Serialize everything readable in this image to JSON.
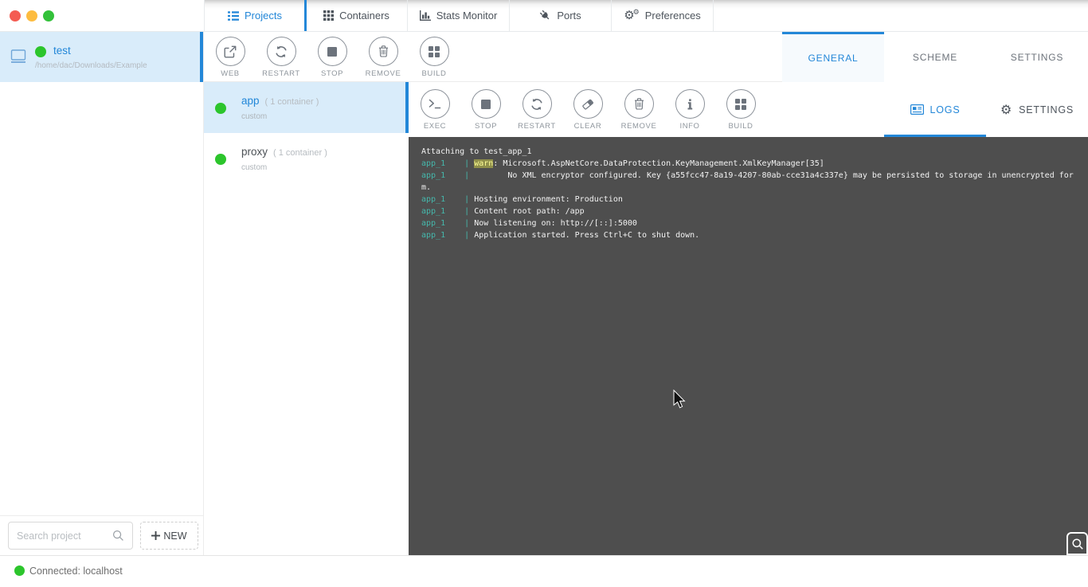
{
  "window": {
    "traffic_lights": [
      {
        "name": "close",
        "color": "#f45c52"
      },
      {
        "name": "minimize",
        "color": "#fdbc40"
      },
      {
        "name": "maximize",
        "color": "#33c13a"
      }
    ]
  },
  "nav": {
    "tabs": [
      {
        "label": "Projects",
        "icon": "list-icon",
        "active": true
      },
      {
        "label": "Containers",
        "icon": "grid9-icon",
        "active": false
      },
      {
        "label": "Stats Monitor",
        "icon": "bars-icon",
        "active": false
      },
      {
        "label": "Ports",
        "icon": "plug-icon",
        "active": false
      },
      {
        "label": "Preferences",
        "icon": "gears-icon",
        "active": false
      }
    ]
  },
  "sidebar": {
    "project": {
      "name": "test",
      "path": "/home/dac/Downloads/Example",
      "status": "running"
    },
    "search_placeholder": "Search project",
    "new_button_label": "NEW"
  },
  "project_toolbar": {
    "buttons": [
      {
        "label": "WEB",
        "icon": "external-link-icon"
      },
      {
        "label": "RESTART",
        "icon": "refresh-icon"
      },
      {
        "label": "STOP",
        "icon": "stop-icon"
      },
      {
        "label": "REMOVE",
        "icon": "trash-icon"
      },
      {
        "label": "BUILD",
        "icon": "grid4-icon"
      }
    ]
  },
  "project_tabs": [
    {
      "label": "GENERAL",
      "active": true
    },
    {
      "label": "SCHEME",
      "active": false
    },
    {
      "label": "SETTINGS",
      "active": false
    }
  ],
  "services": [
    {
      "name": "app",
      "count": "( 1 container )",
      "type": "custom",
      "status": "running",
      "selected": true
    },
    {
      "name": "proxy",
      "count": "( 1 container )",
      "type": "custom",
      "status": "running",
      "selected": false
    }
  ],
  "container_toolbar": {
    "buttons": [
      {
        "label": "EXEC",
        "icon": "terminal-icon"
      },
      {
        "label": "STOP",
        "icon": "stop-icon"
      },
      {
        "label": "RESTART",
        "icon": "refresh-icon"
      },
      {
        "label": "CLEAR",
        "icon": "eraser-icon"
      },
      {
        "label": "REMOVE",
        "icon": "trash-icon"
      },
      {
        "label": "INFO",
        "icon": "info-icon"
      },
      {
        "label": "BUILD",
        "icon": "grid4-icon"
      }
    ]
  },
  "log_tabs": [
    {
      "label": "LOGS",
      "icon": "logs-icon",
      "active": true
    },
    {
      "label": "SETTINGS",
      "icon": "gear-icon",
      "active": false
    }
  ],
  "logs": {
    "lines": [
      {
        "segments": [
          {
            "t": "Attaching to test_app_1",
            "c": "plain"
          }
        ]
      },
      {
        "segments": [
          {
            "t": "app_1    | ",
            "c": "service"
          },
          {
            "t": "warn",
            "c": "warn"
          },
          {
            "t": ": Microsoft.AspNetCore.DataProtection.KeyManagement.XmlKeyManager[35]",
            "c": "plain"
          }
        ]
      },
      {
        "segments": [
          {
            "t": "app_1    | ",
            "c": "service"
          },
          {
            "t": "       No XML encryptor configured. Key {a55fcc47-8a19-4207-80ab-cce31a4c337e} may be persisted to storage in unencrypted for",
            "c": "plain"
          }
        ]
      },
      {
        "segments": [
          {
            "t": "m.",
            "c": "plain"
          }
        ]
      },
      {
        "segments": [
          {
            "t": "app_1    | ",
            "c": "service"
          },
          {
            "t": "Hosting environment: Production",
            "c": "plain"
          }
        ]
      },
      {
        "segments": [
          {
            "t": "app_1    | ",
            "c": "service"
          },
          {
            "t": "Content root path: /app",
            "c": "plain"
          }
        ]
      },
      {
        "segments": [
          {
            "t": "app_1    | ",
            "c": "service"
          },
          {
            "t": "Now listening on: http://[::]:5000",
            "c": "plain"
          }
        ]
      },
      {
        "segments": [
          {
            "t": "app_1    | ",
            "c": "service"
          },
          {
            "t": "Application started. Press Ctrl+C to shut down.",
            "c": "plain"
          }
        ]
      }
    ]
  },
  "status_bar": {
    "text": "Connected: localhost",
    "status": "connected"
  },
  "colors": {
    "accent": "#2387d8",
    "selection_bg": "#d9ecfa",
    "running_green": "#2cc52c",
    "log_bg": "#4e4e4e",
    "log_text": "#f2f2f2",
    "service_teal": "#45b8ac",
    "warn_bg": "#8f8f4a",
    "warn_text": "#fdfd96"
  }
}
